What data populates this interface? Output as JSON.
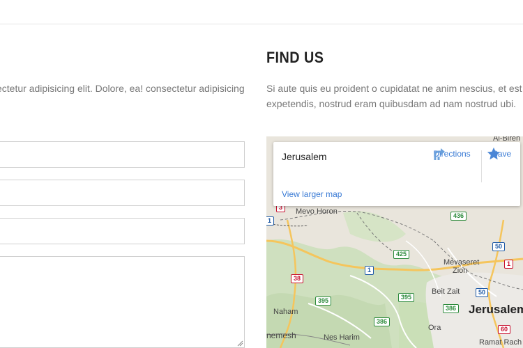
{
  "contact": {
    "paragraph": "sectetur adipisicing elit. Dolore, ea! consectetur adipisicing"
  },
  "find_us": {
    "title": "FIND US",
    "paragraph_line1": "Si aute quis eu proident o cupidatat ne anim nescius, et est p",
    "paragraph_line2": "expetendis, nostrud eram quibusdam ad nam nostrud ubi."
  },
  "map": {
    "place_name": "Jerusalem",
    "directions_label": "Directions",
    "save_label": "Save",
    "larger_map_label": "View larger map",
    "labels": {
      "al_bireh": "Al-Bireh",
      "mevo_horon": "Mevo Horon",
      "mevaseret_zion_1": "Mevaseret",
      "mevaseret_zion_2": "Zion",
      "beit_zait": "Beit Zait",
      "naham": "Naham",
      "jerusalem": "Jerusalem",
      "ora": "Ora",
      "nes_harim": "Nes Harim",
      "beit_shemesh": "nemesh",
      "ramat_rachel": "Ramat Rach"
    },
    "shields": {
      "r3": "3",
      "r1_left": "1",
      "r436": "436",
      "r425": "425",
      "r1_mid": "1",
      "r50_top": "50",
      "r1_right": "1",
      "r38": "38",
      "r395_a": "395",
      "r395_b": "395",
      "r386_a": "386",
      "r386_b": "386",
      "r50_low": "50",
      "r60": "60"
    }
  },
  "colors": {
    "heading": "#222222",
    "body_text": "#777777",
    "link_blue": "#3a7bd5",
    "field_border": "#cfcfcf"
  }
}
